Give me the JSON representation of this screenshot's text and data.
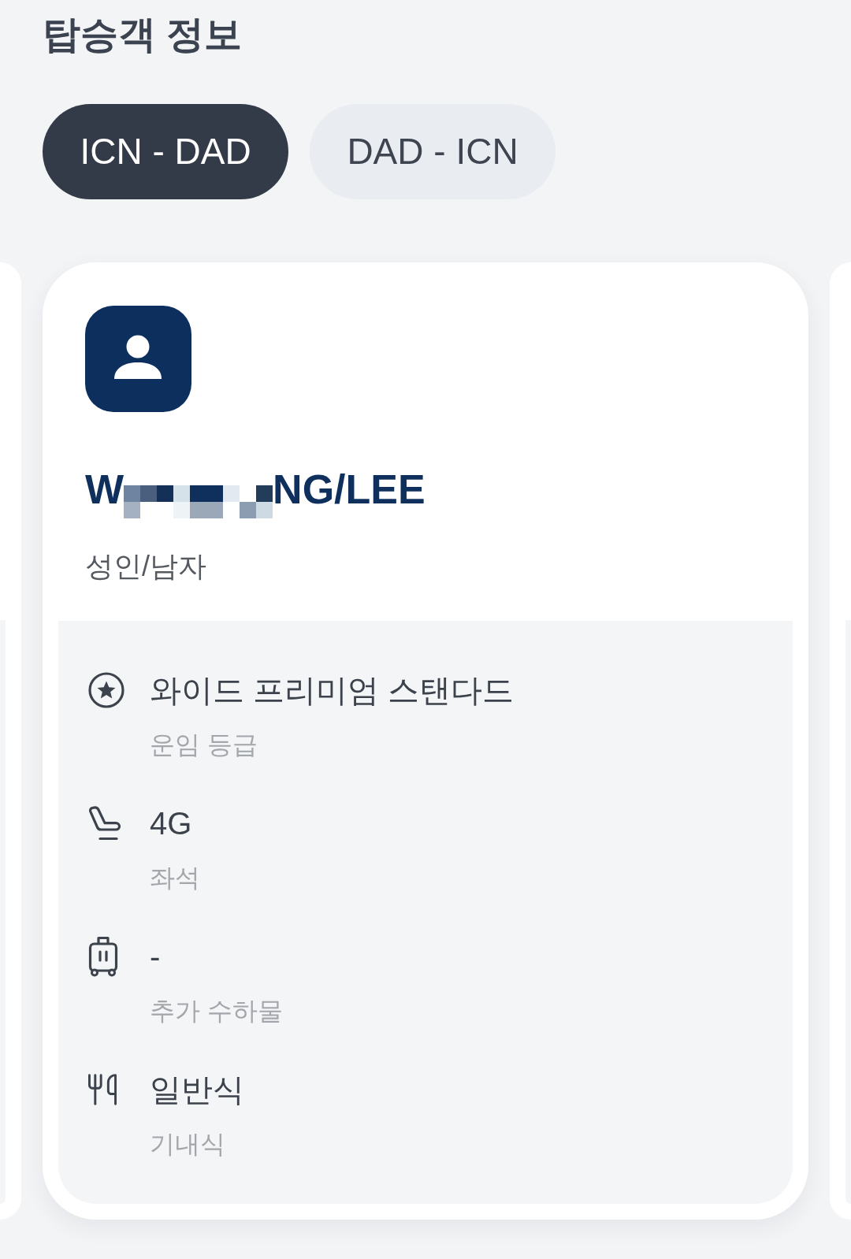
{
  "title": "탑승객 정보",
  "tabs": [
    {
      "label": "ICN - DAD",
      "selected": true
    },
    {
      "label": "DAD - ICN",
      "selected": false
    }
  ],
  "passenger_card": {
    "name": {
      "before_redaction": "W",
      "after_redaction": "NG/LEE"
    },
    "passenger_type": "성인/남자",
    "details": [
      {
        "kind": "fare",
        "value": "와이드 프리미엄 스탠다드",
        "label": "운임 등급"
      },
      {
        "kind": "seat",
        "value": "4G",
        "label": "좌석"
      },
      {
        "kind": "baggage",
        "value": "-",
        "label": "추가 수하물"
      },
      {
        "kind": "meal",
        "value": "일반식",
        "label": "기내식"
      }
    ]
  }
}
